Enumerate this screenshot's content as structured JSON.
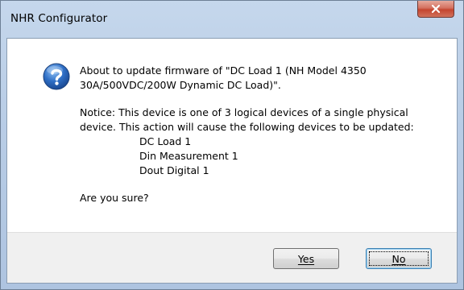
{
  "window": {
    "title": "NHR Configurator",
    "close_icon": "close-x-icon"
  },
  "dialog": {
    "icon": "question-mark-icon",
    "line1": "About to update firmware of \"DC Load 1 (NH Model 4350",
    "line2": "30A/500VDC/200W Dynamic DC Load)\".",
    "notice_line1": "Notice:  This device is one of 3 logical devices of a single physical",
    "notice_line2": "device.  This action will cause the following devices to be updated:",
    "devices": [
      "DC Load 1",
      "Din Measurement 1",
      "Dout Digital 1"
    ],
    "question": "Are you sure?"
  },
  "buttons": {
    "yes_label": "Yes",
    "no_label": "No",
    "default": "No"
  },
  "colors": {
    "frame": "#b9cde6",
    "close_button": "#c4452f",
    "button_bar": "#f0f0f0",
    "icon_blue": "#2a62b8"
  }
}
